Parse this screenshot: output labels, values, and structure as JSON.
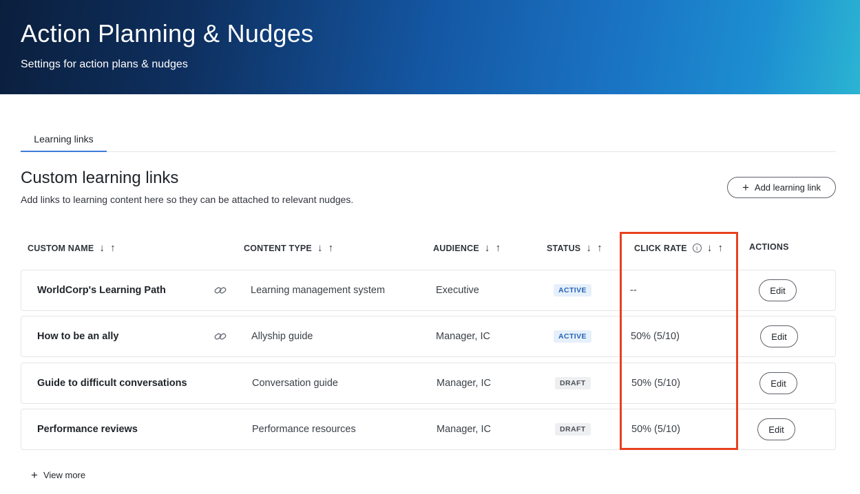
{
  "header": {
    "title": "Action Planning & Nudges",
    "subtitle": "Settings for action plans & nudges"
  },
  "tabs": [
    {
      "label": "Learning links",
      "active": true
    }
  ],
  "section": {
    "title": "Custom learning links",
    "description": "Add links to learning content here so they can be attached to relevant nudges.",
    "add_button_label": "Add learning link"
  },
  "table": {
    "columns": [
      {
        "key": "name",
        "label": "CUSTOM NAME",
        "sortable": true
      },
      {
        "key": "content_type",
        "label": "CONTENT TYPE",
        "sortable": true
      },
      {
        "key": "audience",
        "label": "AUDIENCE",
        "sortable": true
      },
      {
        "key": "status",
        "label": "STATUS",
        "sortable": true
      },
      {
        "key": "click_rate",
        "label": "CLICK RATE",
        "sortable": true,
        "info": true
      },
      {
        "key": "actions",
        "label": "ACTIONS",
        "sortable": false
      }
    ],
    "rows": [
      {
        "name": "WorldCorp's Learning Path",
        "has_link_icon": true,
        "content_type": "Learning management system",
        "audience": "Executive",
        "status": "ACTIVE",
        "click_rate": "--",
        "action_label": "Edit"
      },
      {
        "name": "How to be an ally",
        "has_link_icon": true,
        "content_type": "Allyship guide",
        "audience": "Manager, IC",
        "status": "ACTIVE",
        "click_rate": "50% (5/10)",
        "action_label": "Edit"
      },
      {
        "name": "Guide to difficult conversations",
        "has_link_icon": false,
        "content_type": "Conversation guide",
        "audience": "Manager, IC",
        "status": "DRAFT",
        "click_rate": "50% (5/10)",
        "action_label": "Edit"
      },
      {
        "name": "Performance reviews",
        "has_link_icon": false,
        "content_type": "Performance resources",
        "audience": "Manager, IC",
        "status": "DRAFT",
        "click_rate": "50% (5/10)",
        "action_label": "Edit"
      }
    ]
  },
  "footer": {
    "view_more_label": "View more"
  },
  "icons": {
    "sort_down": "arrow-down-icon",
    "sort_up": "arrow-up-icon",
    "info": "info-icon",
    "link": "link-icon",
    "plus": "plus-icon"
  },
  "colors": {
    "highlight": "#e8401f",
    "tab_underline": "#3d7bd9",
    "active_badge": "#2563b8",
    "header_gradient_start": "#0b1f3d",
    "header_gradient_end": "#2bb4d3"
  }
}
